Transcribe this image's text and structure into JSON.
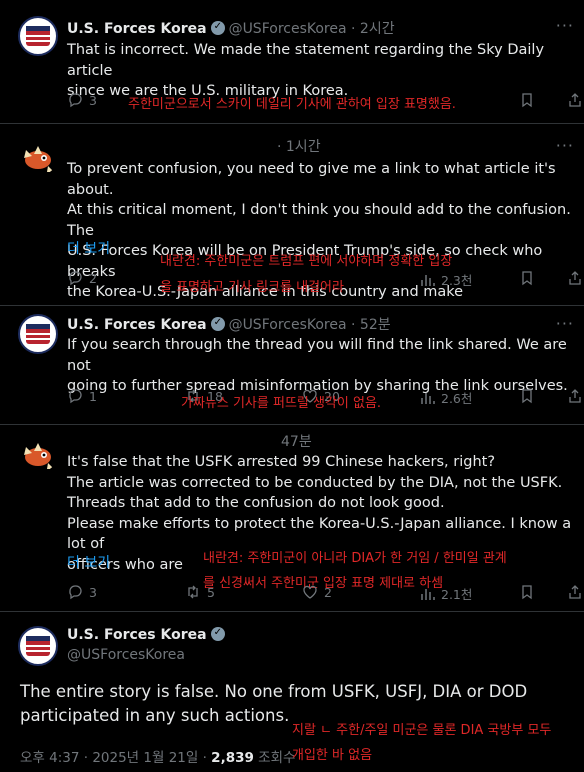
{
  "tweets": [
    {
      "name": "U.S. Forces Korea",
      "handle": "@USForcesKorea",
      "time": "· 2시간",
      "lines": [
        "That is incorrect. We made the statement regarding the Sky Daily article",
        "since we are the U.S. military in Korea."
      ],
      "reply_count": "3",
      "retweet_count": "",
      "like_count": "",
      "view_count": "",
      "annotation": [
        "주한미군으로서 스카이 데일리 기사에 관하여 입장 표명했음."
      ]
    },
    {
      "name": "",
      "handle": "",
      "time": "· 1시간",
      "lines": [
        "To prevent confusion, you need to give me a link to what article it's about.",
        "At this critical moment, I don't think you should add to the confusion. The",
        "U.S. Forces Korea will be on President Trump's side, so check who breaks",
        "the Korea-U.S.-Japan alliance in this country and make"
      ],
      "show_more": "더 보기",
      "reply_count": "2",
      "retweet_count": "",
      "like_count": "",
      "view_count": "2.3천",
      "annotation": [
        "내란견: 주한미군은 트럼프 편에 서야하며 정확한 입장",
        "을 표명하고 기사 링크를 내걸어라"
      ]
    },
    {
      "name": "U.S. Forces Korea",
      "handle": "@USForcesKorea",
      "time": "· 52분",
      "lines": [
        "If you search through the thread you will find the link shared. We are not",
        "going to further spread misinformation by sharing the link ourselves."
      ],
      "reply_count": "1",
      "retweet_count": "18",
      "like_count": "20",
      "view_count": "2.6천",
      "annotation": [
        "가짜뉴스 기사를 퍼뜨릴 생각이 없음."
      ]
    },
    {
      "name": "",
      "handle": "",
      "time": "47분",
      "lines": [
        "It's false that the USFK arrested 99 Chinese hackers, right?",
        "The article was corrected to be conducted by the DIA, not the USFK.",
        "Threads that add to the confusion do not look good.",
        "Please make efforts to protect the Korea-U.S.-Japan alliance. I know a lot of",
        "officers who are"
      ],
      "show_more": "더 보기",
      "reply_count": "3",
      "retweet_count": "5",
      "like_count": "2",
      "view_count": "2.1천",
      "annotation": [
        "내란견: 주한미군이 아니라 DIA가 한 거임 / 한미일 관계",
        "를 신경써서 주한미군 입장 표명 제대로 하셈"
      ]
    }
  ],
  "main_tweet": {
    "name": "U.S. Forces Korea",
    "handle": "@USForcesKorea",
    "lines": [
      "The entire story is false. No one from USFK, USFJ, DIA or DOD",
      "participated in any such actions."
    ],
    "time": "오후 4:37 · 2025년 1월 21일 · ",
    "views": "2,839",
    "views_label": " 조회수",
    "annotation": [
      "지랄 ㄴ 주한/주일 미군은 물론 DIA 국방부 모두",
      "개입한 바 없음"
    ]
  },
  "colors": {
    "accent": "#1d9bf0",
    "annotation": "#e02828",
    "muted": "#71767b"
  },
  "icons": [
    "reply-icon",
    "retweet-icon",
    "like-icon",
    "views-icon",
    "bookmark-icon",
    "share-icon",
    "verified-badge-icon",
    "more-icon"
  ]
}
